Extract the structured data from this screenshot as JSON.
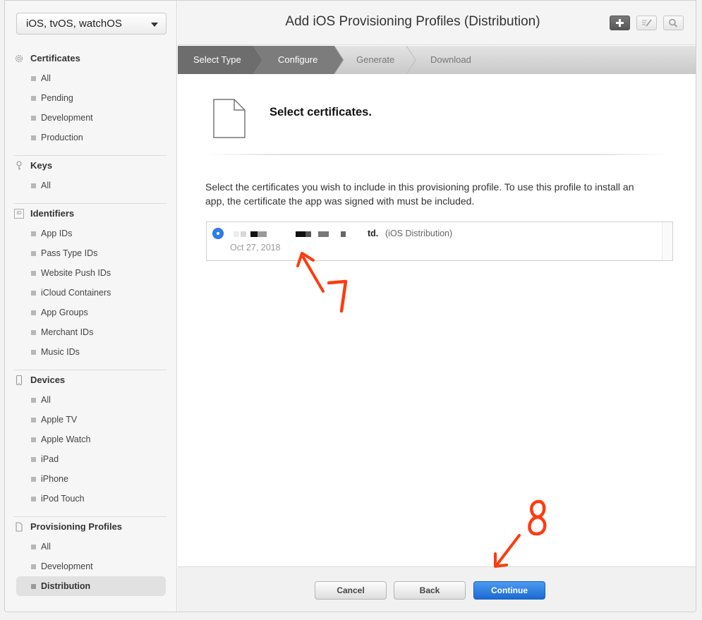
{
  "platform_select": {
    "value": "iOS, tvOS, watchOS"
  },
  "sidebar": {
    "certificates": {
      "label": "Certificates",
      "items": [
        "All",
        "Pending",
        "Development",
        "Production"
      ]
    },
    "keys": {
      "label": "Keys",
      "items": [
        "All"
      ]
    },
    "identifiers": {
      "label": "Identifiers",
      "icon_text": "ID",
      "items": [
        "App IDs",
        "Pass Type IDs",
        "Website Push IDs",
        "iCloud Containers",
        "App Groups",
        "Merchant IDs",
        "Music IDs"
      ]
    },
    "devices": {
      "label": "Devices",
      "items": [
        "All",
        "Apple TV",
        "Apple Watch",
        "iPad",
        "iPhone",
        "iPod Touch"
      ]
    },
    "profiles": {
      "label": "Provisioning Profiles",
      "items": [
        "All",
        "Development",
        "Distribution"
      ],
      "active": "Distribution"
    }
  },
  "header": {
    "title": "Add iOS Provisioning Profiles (Distribution)"
  },
  "steps": [
    "Select Type",
    "Configure",
    "Generate",
    "Download"
  ],
  "content": {
    "section_title": "Select certificates.",
    "instructions": "Select the certificates you wish to include in this provisioning profile. To use this profile to install an app, the certificate the app was signed with must be included.",
    "certificate": {
      "name_suffix": "td.",
      "type": "(iOS Distribution)",
      "date": "Oct 27, 2018"
    }
  },
  "footer": {
    "cancel": "Cancel",
    "back": "Back",
    "continue": "Continue"
  },
  "annotations": [
    "7",
    "8"
  ],
  "colors": {
    "accent": "#1c69d3",
    "annotation": "#ff3b10"
  }
}
